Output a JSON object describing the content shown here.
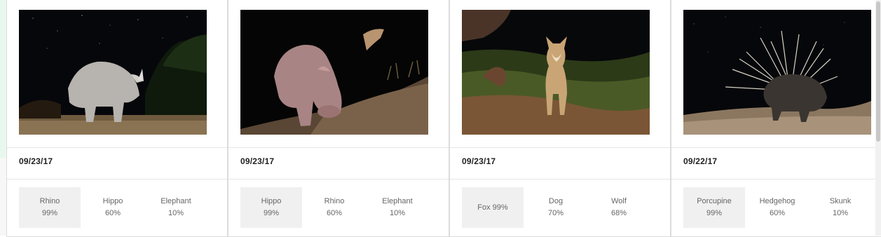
{
  "cards": [
    {
      "date": "09/23/17",
      "photo_subject": "rhino",
      "predictions": [
        {
          "label": "Rhino",
          "score": "99%"
        },
        {
          "label": "Hippo",
          "score": "60%"
        },
        {
          "label": "Elephant",
          "score": "10%"
        }
      ]
    },
    {
      "date": "09/23/17",
      "photo_subject": "hippo",
      "predictions": [
        {
          "label": "Hippo",
          "score": "99%"
        },
        {
          "label": "Rhino",
          "score": "60%"
        },
        {
          "label": "Elephant",
          "score": "10%"
        }
      ]
    },
    {
      "date": "09/23/17",
      "photo_subject": "fox",
      "predictions": [
        {
          "label": "Fox 99%"
        },
        {
          "label": "Dog",
          "score": "70%"
        },
        {
          "label": "Wolf",
          "score": "68%"
        }
      ]
    },
    {
      "date": "09/22/17",
      "photo_subject": "porcupine",
      "predictions": [
        {
          "label": "Porcupine",
          "score": "99%"
        },
        {
          "label": "Hedgehog",
          "score": "60%"
        },
        {
          "label": "Skunk",
          "score": "10%"
        }
      ]
    }
  ],
  "colors": {
    "page_band": "#e8f8ef",
    "top_prediction_bg": "#f0f0f0",
    "date_text": "#1f1f1f",
    "prediction_text": "#666666"
  }
}
